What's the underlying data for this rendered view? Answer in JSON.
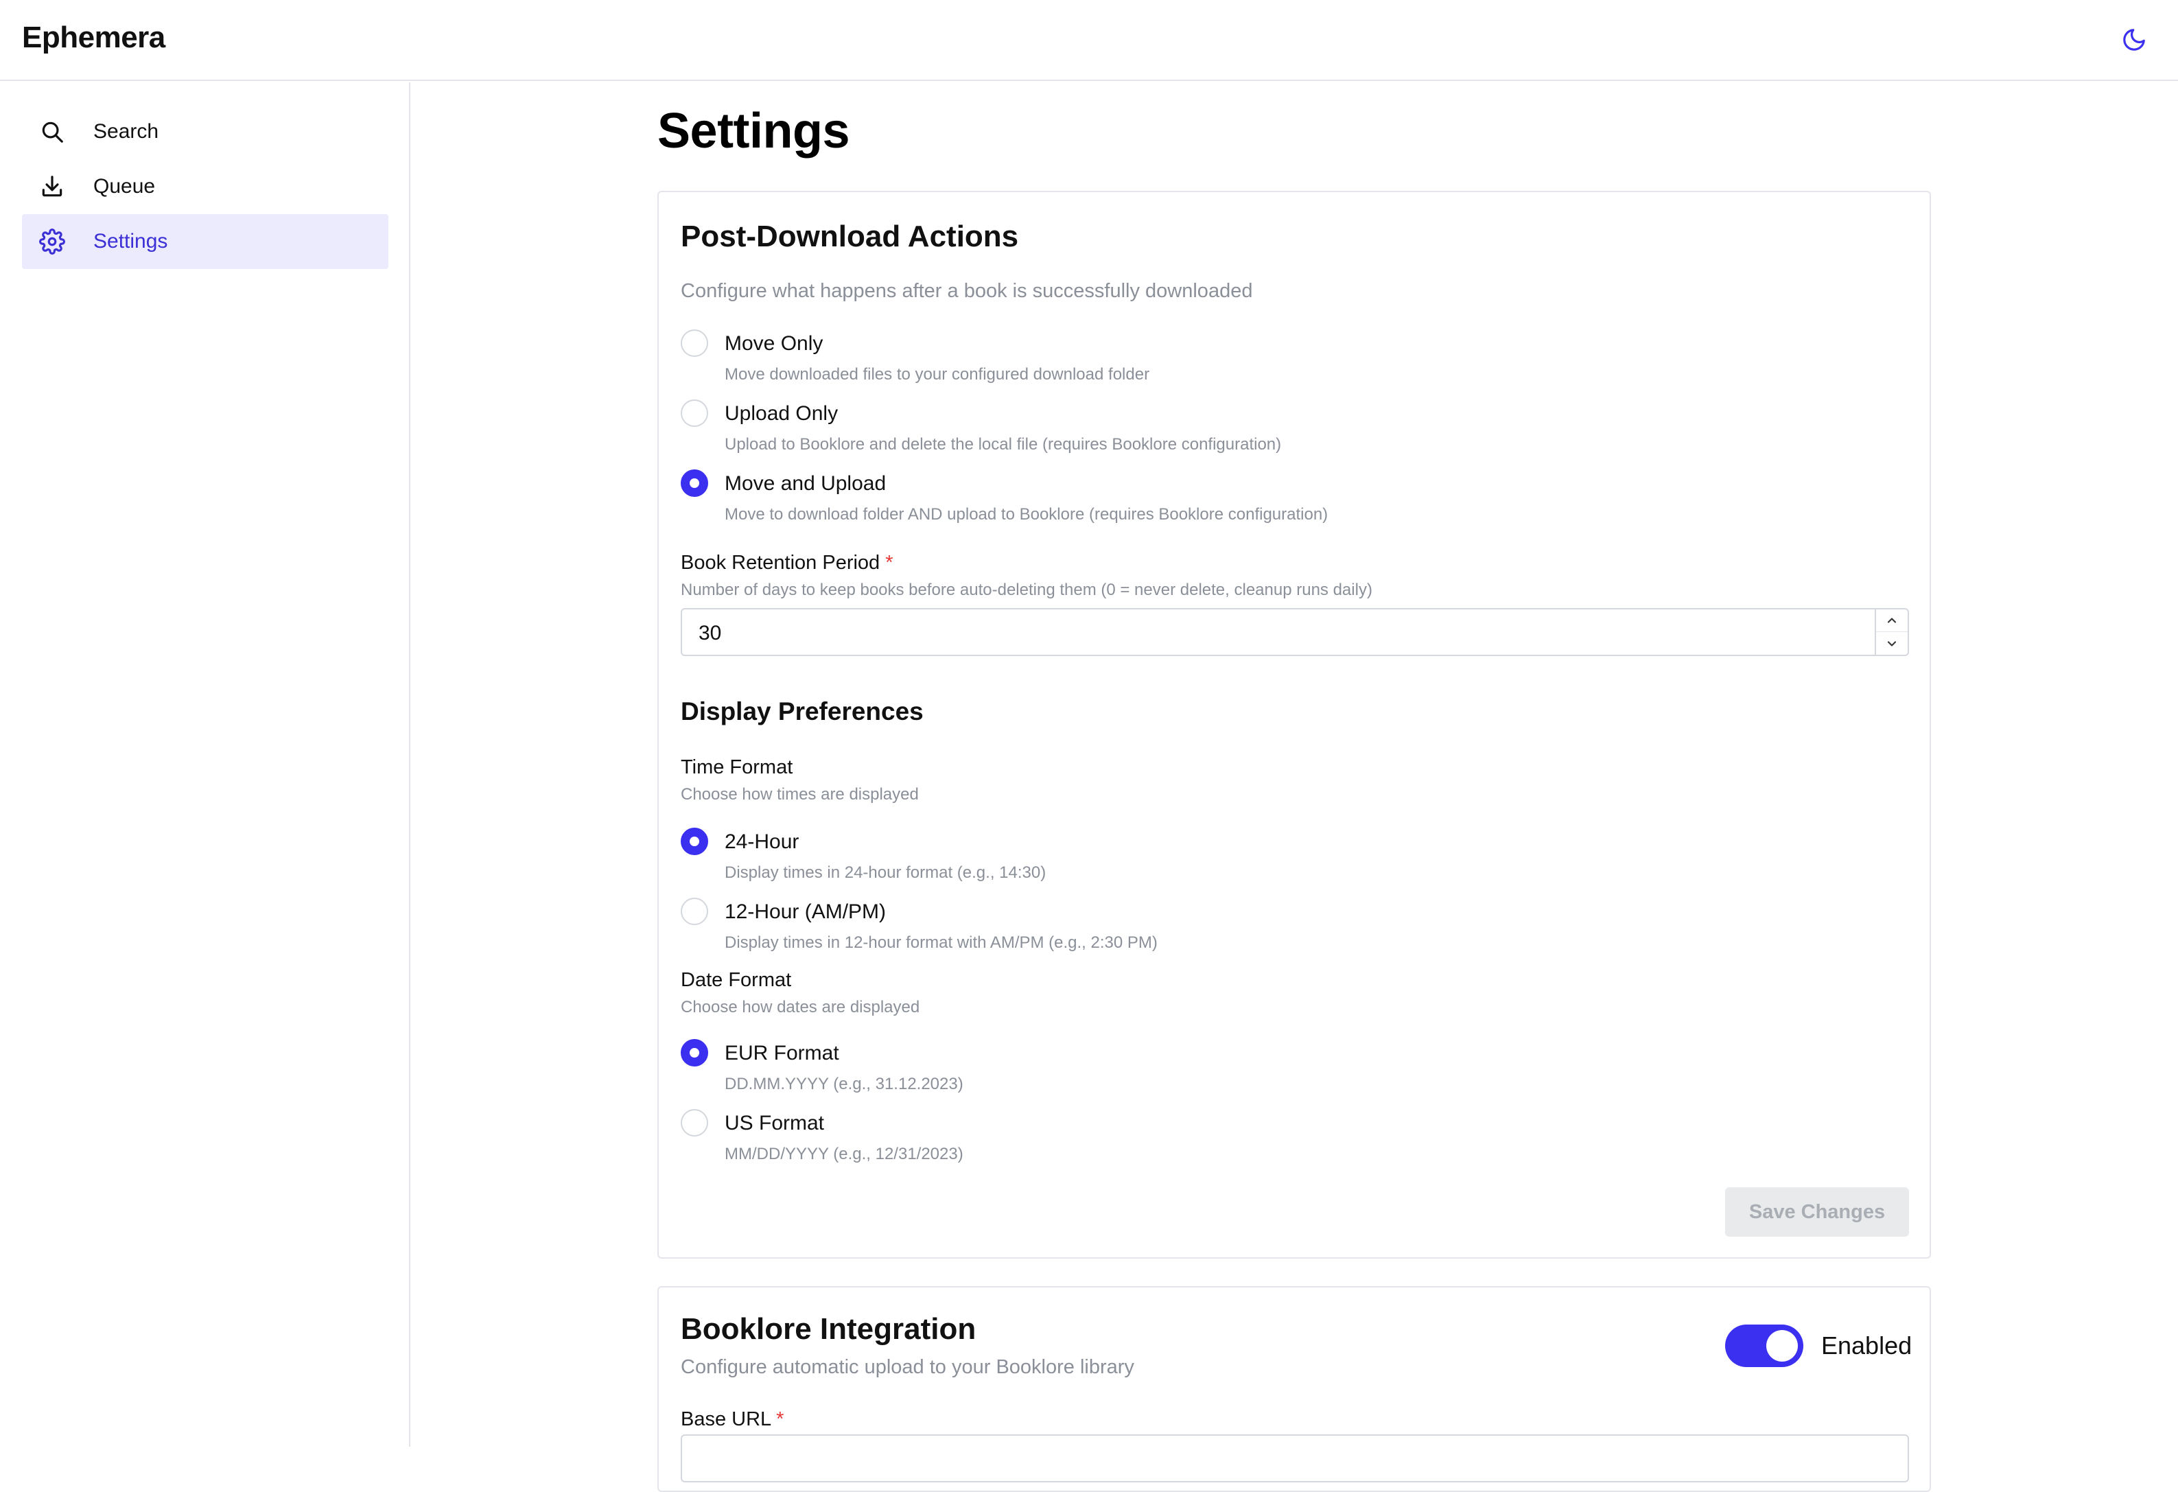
{
  "app": {
    "title": "Ephemera"
  },
  "header": {
    "theme_icon": "moon-icon"
  },
  "sidebar": {
    "items": [
      {
        "label": "Search",
        "icon": "search-icon",
        "active": false
      },
      {
        "label": "Queue",
        "icon": "download-icon",
        "active": false
      },
      {
        "label": "Settings",
        "icon": "gear-icon",
        "active": true
      }
    ]
  },
  "page": {
    "title": "Settings"
  },
  "post_download": {
    "title": "Post-Download Actions",
    "description": "Configure what happens after a book is successfully downloaded",
    "options": [
      {
        "label": "Move Only",
        "desc": "Move downloaded files to your configured download folder",
        "selected": false
      },
      {
        "label": "Upload Only",
        "desc": "Upload to Booklore and delete the local file (requires Booklore configuration)",
        "selected": false
      },
      {
        "label": "Move and Upload",
        "desc": "Move to download folder AND upload to Booklore (requires Booklore configuration)",
        "selected": true
      }
    ],
    "retention": {
      "label": "Book Retention Period",
      "required_mark": "*",
      "help": "Number of days to keep books before auto-deleting them (0 = never delete, cleanup runs daily)",
      "value": "30"
    }
  },
  "display": {
    "title": "Display Preferences",
    "time_format": {
      "label": "Time Format",
      "help": "Choose how times are displayed",
      "options": [
        {
          "label": "24-Hour",
          "desc": "Display times in 24-hour format (e.g., 14:30)",
          "selected": true
        },
        {
          "label": "12-Hour (AM/PM)",
          "desc": "Display times in 12-hour format with AM/PM (e.g., 2:30 PM)",
          "selected": false
        }
      ]
    },
    "date_format": {
      "label": "Date Format",
      "help": "Choose how dates are displayed",
      "options": [
        {
          "label": "EUR Format",
          "desc": "DD.MM.YYYY (e.g., 31.12.2023)",
          "selected": true
        },
        {
          "label": "US Format",
          "desc": "MM/DD/YYYY (e.g., 12/31/2023)",
          "selected": false
        }
      ]
    }
  },
  "save_button": {
    "label": "Save Changes",
    "enabled": false
  },
  "booklore": {
    "title": "Booklore Integration",
    "description": "Configure automatic upload to your Booklore library",
    "toggle_label": "Enabled",
    "toggle_on": true,
    "base_url": {
      "label": "Base URL",
      "required_mark": "*",
      "value": ""
    }
  },
  "colors": {
    "accent": "#3b2ff0",
    "active_nav_bg": "#eceafd",
    "active_nav_text": "#3b2fd6",
    "required": "#e53935",
    "muted_text": "#8a8f98",
    "border": "#e3e5ea"
  }
}
